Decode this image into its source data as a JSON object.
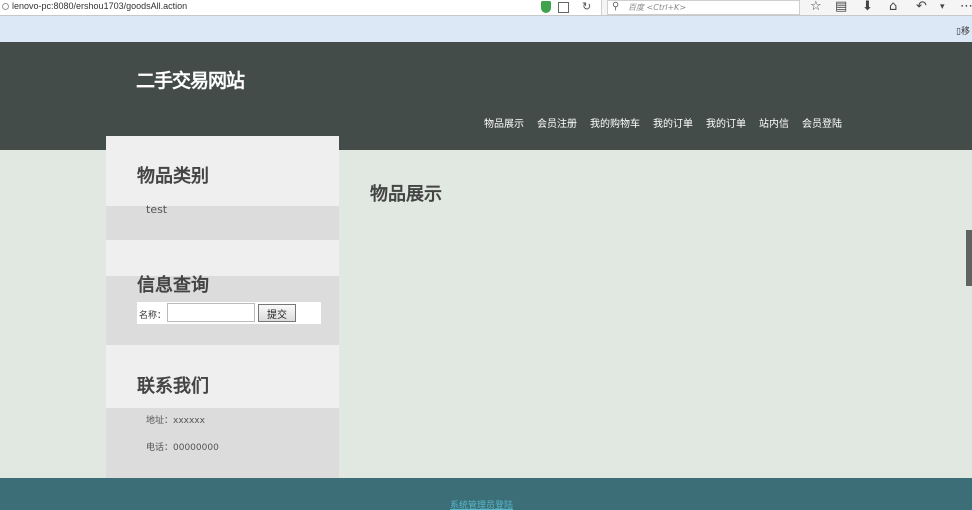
{
  "browser": {
    "url": "lenovo-pc:8080/ershou1703/goodsAll.action",
    "search_placeholder": "百度 <Ctrl+K>",
    "bookmark_label": "移"
  },
  "header": {
    "site_title": "二手交易网站",
    "nav": [
      "物品展示",
      "会员注册",
      "我的购物车",
      "我的订单",
      "我的订单",
      "站内信",
      "会员登陆"
    ]
  },
  "sidebar": {
    "categories": {
      "title": "物品类别",
      "items": [
        "test"
      ]
    },
    "query": {
      "title": "信息查询",
      "label": "名称：",
      "input_value": "",
      "submit_label": "提交"
    },
    "contact": {
      "title": "联系我们",
      "address": "地址：xxxxxx",
      "phone": "电话：00000000"
    }
  },
  "main": {
    "title": "物品展示"
  },
  "footer": {
    "admin_link": "系统管理员登陆"
  }
}
